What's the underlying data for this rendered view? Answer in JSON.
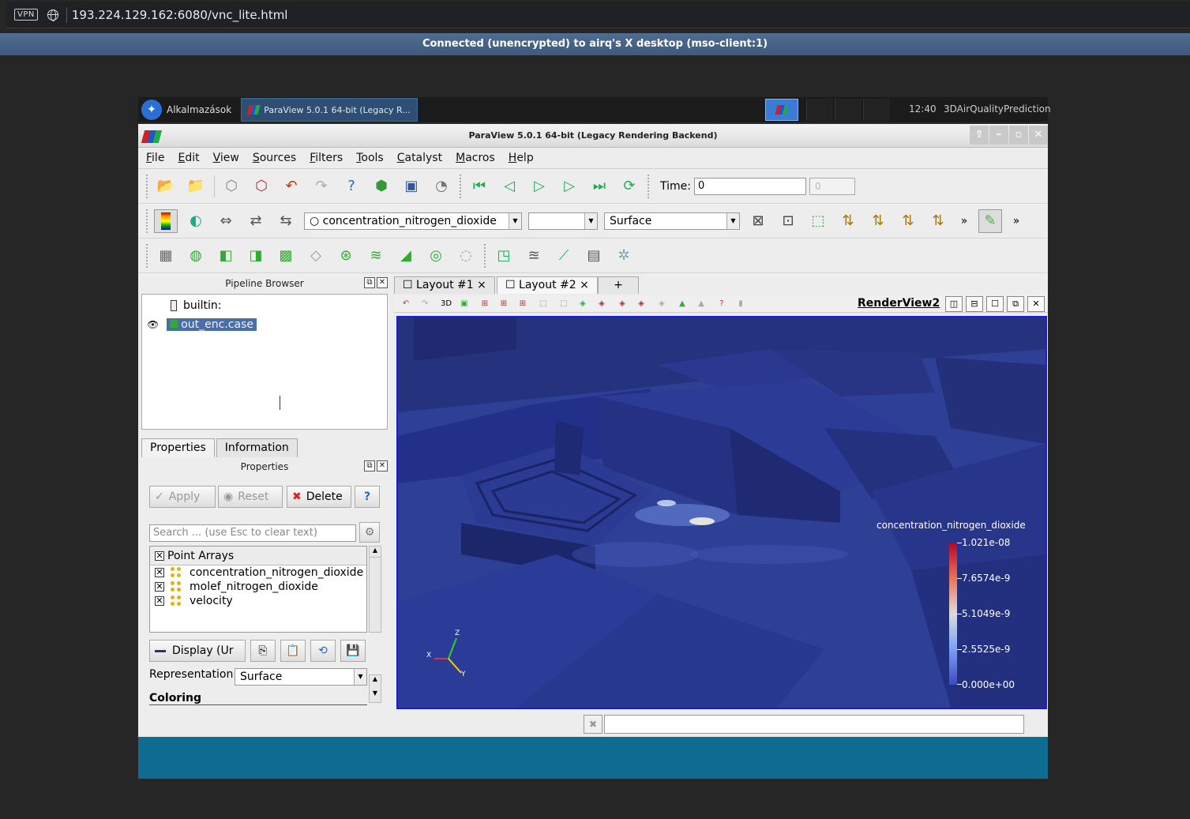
{
  "browser": {
    "vpn_label": "VPN",
    "url": "193.224.129.162:6080/vnc_lite.html"
  },
  "vnc": {
    "status": "Connected (unencrypted) to airq's X desktop (mso-client:1)"
  },
  "taskbar": {
    "apps_label": "Alkalmazások",
    "task_title": "ParaView 5.0.1 64-bit (Legacy R...",
    "clock": "12:40",
    "host": "3DAirQualityPrediction"
  },
  "window": {
    "title": "ParaView 5.0.1 64-bit (Legacy Rendering Backend)"
  },
  "menu": [
    "File",
    "Edit",
    "View",
    "Sources",
    "Filters",
    "Tools",
    "Catalyst",
    "Macros",
    "Help"
  ],
  "toolbar": {
    "time_label": "Time:",
    "time_value": "0",
    "time_step": "0",
    "array_combo": "concentration_nitrogen_dioxide",
    "representation_combo": "Surface",
    "more": "»"
  },
  "pipeline": {
    "title": "Pipeline Browser",
    "builtin": "builtin:",
    "source": "out_enc.case"
  },
  "properties": {
    "tabs": [
      "Properties",
      "Information"
    ],
    "panel_title": "Properties",
    "apply": "Apply",
    "reset": "Reset",
    "delete": "Delete",
    "help": "?",
    "search_placeholder": "Search ... (use Esc to clear text)",
    "arrays_header": "Point Arrays",
    "arrays": [
      "concentration_nitrogen_dioxide",
      "molef_nitrogen_dioxide",
      "velocity"
    ],
    "display_label": "Display (Ur",
    "representation_label": "Representation",
    "representation_value": "Surface",
    "coloring_label": "Coloring"
  },
  "layout": {
    "tabs": [
      "Layout #1",
      "Layout #2"
    ],
    "add": "+",
    "close": "×",
    "view_name": "RenderView2",
    "mode_3d": "3D"
  },
  "legend": {
    "title": "concentration_nitrogen_dioxide",
    "labels": [
      "1.021e-08",
      "7.6574e-9",
      "5.1049e-9",
      "2.5525e-9",
      "0.000e+00"
    ]
  },
  "axes": {
    "x": "X",
    "y": "Y",
    "z": "Z"
  },
  "colors": {
    "selection": "#4a6fa5",
    "viewport_border": "#1a1ae0",
    "scene": "#2d3d93"
  }
}
